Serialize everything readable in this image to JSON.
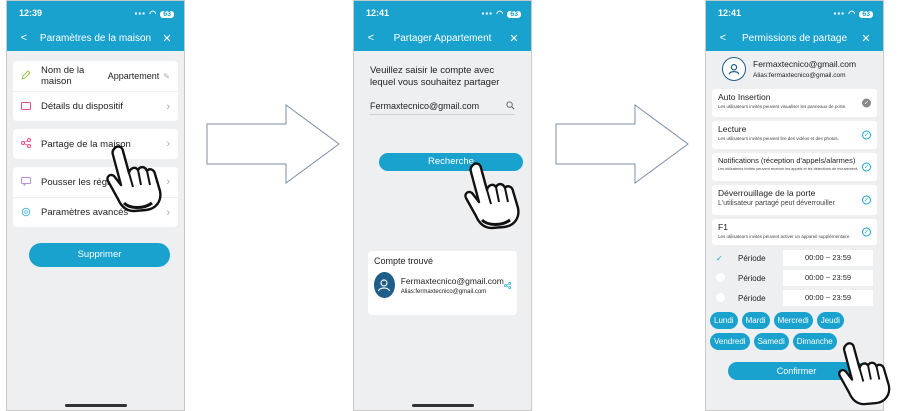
{
  "screen1": {
    "time": "12:39",
    "battery": "63",
    "nav": {
      "back": "<",
      "title": "Paramètres de la maison",
      "close": "✕"
    },
    "items": [
      {
        "label": "Nom de la maison",
        "value": "Appartement",
        "icon": "pencil-edit-icon"
      },
      {
        "label": "Détails du dispositif",
        "icon": "device-icon"
      },
      {
        "label": "Partage de la maison",
        "icon": "share-icon"
      },
      {
        "label": "Pousser les réglages",
        "icon": "message-icon"
      },
      {
        "label": "Paramètres avancés",
        "icon": "settings-icon"
      }
    ],
    "delete_button": "Supprimer"
  },
  "screen2": {
    "time": "12:41",
    "battery": "63",
    "nav": {
      "back": "<",
      "title": "Partager Appartement",
      "close": "✕"
    },
    "prompt": "Veuillez saisir le compte avec lequel vous souhaitez partager",
    "email_value": "Fermaxtecnico@gmail.com",
    "search_button": "Recherche",
    "found": {
      "title": "Compte trouvé",
      "email": "Fermaxtecnico@gmail.com",
      "alias": "Alias:fermaxtecnico@gmail.com"
    }
  },
  "screen3": {
    "time": "12:41",
    "battery": "63",
    "nav": {
      "back": "<",
      "title": "Permissions de partage",
      "close": "✕"
    },
    "user": {
      "email": "Fermaxtecnico@gmail.com",
      "alias": "Alias:fermaxtecnico@gmail.com"
    },
    "permissions": [
      {
        "title": "Auto Insertion",
        "desc": "Les utilisateurs invités peuvent visualiser les panneaux de porte."
      },
      {
        "title": "Lecture",
        "desc": "Les utilisateurs invités peuvent lire des vidéos et des photos."
      },
      {
        "title": "Notifications (réception d'appels/alarmes)",
        "desc": "Les utilisateurs invités peuvent recevoir les appels et les détections de mouvement."
      },
      {
        "title": "Déverrouillage de la porte",
        "desc": "L'utilisateur partagé peut déverrouiller"
      },
      {
        "title": "F1",
        "desc": "Les utilisateurs invités peuvent activer un appareil supplémentaire."
      }
    ],
    "periods": [
      {
        "label": "Période",
        "time": "00:00 ~ 23:59",
        "checked": true
      },
      {
        "label": "Période",
        "time": "00:00 ~ 23:59",
        "checked": false
      },
      {
        "label": "Période",
        "time": "00:00 ~ 23:59",
        "checked": false
      }
    ],
    "days": [
      "Lundi",
      "Mardi",
      "Mercredi",
      "Jeudi",
      "Vendredi",
      "Samedi",
      "Dimanche"
    ],
    "confirm_button": "Confirmer"
  },
  "colors": {
    "accent": "#1aa2cf",
    "background": "#eeeff1",
    "avatar": "#1d5f8a"
  }
}
